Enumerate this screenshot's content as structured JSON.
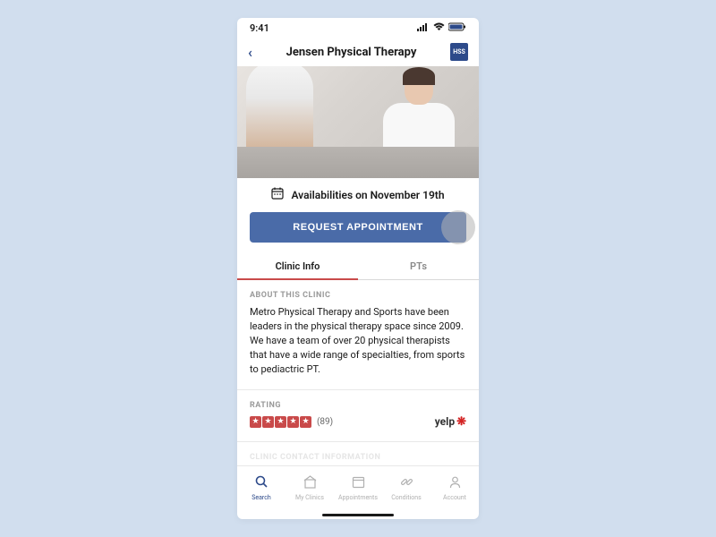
{
  "statusbar": {
    "time": "9:41"
  },
  "nav": {
    "title": "Jensen Physical Therapy",
    "badge": "HSS"
  },
  "availability": {
    "text": "Availabilities on November 19th"
  },
  "cta": {
    "label": "REQUEST APPOINTMENT"
  },
  "tabs": {
    "clinic_info": "Clinic Info",
    "pts": "PTs"
  },
  "about": {
    "heading": "ABOUT THIS CLINIC",
    "body": "Metro Physical Therapy and Sports have been leaders in the physical therapy space since 2009. We have a team of over 20 physical therapists that have a wide range of specialties, from sports to pediactric PT."
  },
  "rating": {
    "heading": "RATING",
    "stars": 5,
    "count": "(89)",
    "provider": "yelp"
  },
  "contact": {
    "heading": "CLINIC CONTACT INFORMATION"
  },
  "tabbar": {
    "search": "Search",
    "myclinics": "My Clinics",
    "appointments": "Appointments",
    "conditions": "Conditions",
    "account": "Account"
  }
}
